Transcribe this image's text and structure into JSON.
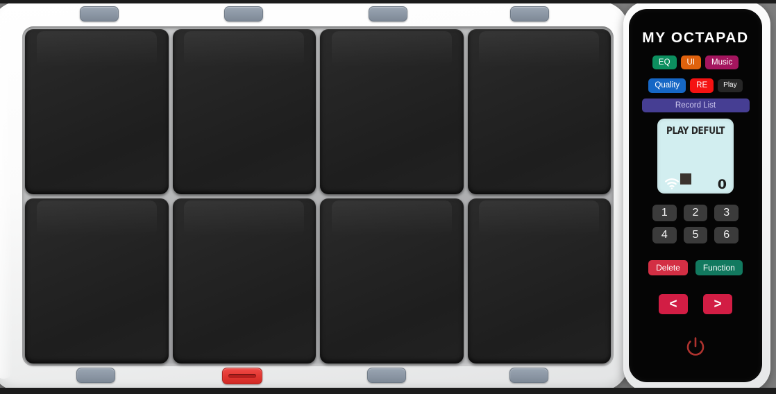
{
  "window": {
    "device_title": "MY OCTAPAD"
  },
  "pads": {
    "count": 8,
    "items": [
      {
        "id": "pad-1",
        "label": ""
      },
      {
        "id": "pad-2",
        "label": ""
      },
      {
        "id": "pad-3",
        "label": ""
      },
      {
        "id": "pad-4",
        "label": ""
      },
      {
        "id": "pad-5",
        "label": ""
      },
      {
        "id": "pad-6",
        "label": ""
      },
      {
        "id": "pad-7",
        "label": ""
      },
      {
        "id": "pad-8",
        "label": ""
      }
    ]
  },
  "chassis_buttons": {
    "top": [
      {
        "name": "chassis-top-1",
        "color": "#8b96a4"
      },
      {
        "name": "chassis-top-2",
        "color": "#8b96a4"
      },
      {
        "name": "chassis-top-3",
        "color": "#8b96a4"
      },
      {
        "name": "chassis-top-4",
        "color": "#8b96a4"
      }
    ],
    "bottom": [
      {
        "name": "chassis-bottom-1",
        "color": "#8b96a4"
      },
      {
        "name": "record-button",
        "color": "#e13630"
      },
      {
        "name": "chassis-bottom-3",
        "color": "#8b96a4"
      },
      {
        "name": "chassis-bottom-4",
        "color": "#8b96a4"
      }
    ]
  },
  "control_panel": {
    "title": "MY OCTAPAD",
    "tags_row1": [
      {
        "label": "EQ",
        "color": "#0c8f5f"
      },
      {
        "label": "UI",
        "color": "#e0620d"
      },
      {
        "label": "Music",
        "color": "#a4155e"
      }
    ],
    "tags_row2": [
      {
        "label": "Quality",
        "color": "#1667c5"
      },
      {
        "label": "RE",
        "color": "#f51212"
      },
      {
        "label": "Play",
        "color": "#262626"
      }
    ],
    "record_list": {
      "label": "Record List",
      "color": "#463e93"
    },
    "display": {
      "title": "PLAY DEFULT",
      "counter": "0",
      "wifi_icon": "wifi-icon",
      "cursor_block": "display-cursor-block",
      "background": "#d2eef0"
    },
    "keypad": [
      "1",
      "2",
      "3",
      "4",
      "5",
      "6"
    ],
    "actions": [
      {
        "label": "Delete",
        "color": "#d32f44"
      },
      {
        "label": "Function",
        "color": "#12795f"
      }
    ],
    "nav": [
      {
        "label": "<",
        "name": "prev-button",
        "color": "#d21d44"
      },
      {
        "label": ">",
        "name": "next-button",
        "color": "#d21d44"
      }
    ],
    "power": {
      "icon": "power-icon",
      "color": "#b0332f"
    }
  }
}
